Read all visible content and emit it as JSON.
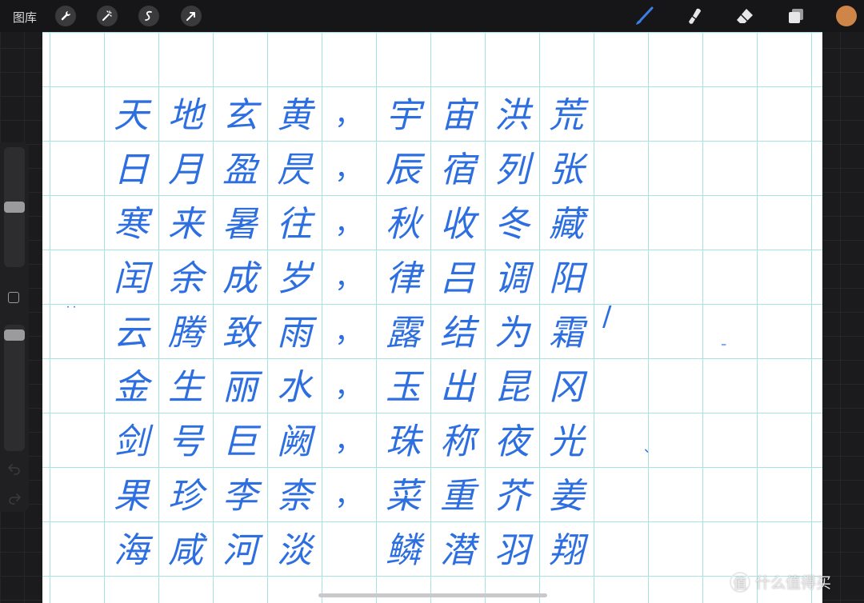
{
  "topbar": {
    "gallery_label": "图库",
    "left_tools": [
      "wrench-icon",
      "magic-wand-icon",
      "selection-icon",
      "transform-arrow-icon"
    ],
    "right_tools": [
      "brush-icon",
      "smudge-icon",
      "eraser-icon",
      "layers-icon"
    ],
    "active_color": "#cf8448",
    "brush_color": "#3b7ee8"
  },
  "sidebar": {
    "brush_size_level": 0.35,
    "opacity_level": 0.1
  },
  "canvas": {
    "ink_color": "#2d6fe0",
    "grid_color": "#a6e4e0",
    "lines": [
      {
        "left": [
          "天",
          "地",
          "玄",
          "黄"
        ],
        "mid": "，",
        "right": [
          "宇",
          "宙",
          "洪",
          "荒"
        ]
      },
      {
        "left": [
          "日",
          "月",
          "盈",
          "昃"
        ],
        "mid": "，",
        "right": [
          "辰",
          "宿",
          "列",
          "张"
        ]
      },
      {
        "left": [
          "寒",
          "来",
          "暑",
          "往"
        ],
        "mid": "，",
        "right": [
          "秋",
          "收",
          "冬",
          "藏"
        ]
      },
      {
        "left": [
          "闰",
          "余",
          "成",
          "岁"
        ],
        "mid": "，",
        "right": [
          "律",
          "吕",
          "调",
          "阳"
        ]
      },
      {
        "left": [
          "云",
          "腾",
          "致",
          "雨"
        ],
        "mid": "，",
        "right": [
          "露",
          "结",
          "为",
          "霜"
        ]
      },
      {
        "left": [
          "金",
          "生",
          "丽",
          "水"
        ],
        "mid": "，",
        "right": [
          "玉",
          "出",
          "昆",
          "冈"
        ]
      },
      {
        "left": [
          "剑",
          "号",
          "巨",
          "阙"
        ],
        "mid": "，",
        "right": [
          "珠",
          "称",
          "夜",
          "光"
        ]
      },
      {
        "left": [
          "果",
          "珍",
          "李",
          "柰"
        ],
        "mid": "，",
        "right": [
          "菜",
          "重",
          "芥",
          "姜"
        ]
      },
      {
        "left": [
          "海",
          "咸",
          "河",
          "淡"
        ],
        "mid": "",
        "right": [
          "鳞",
          "潜",
          "羽",
          "翔"
        ]
      }
    ]
  },
  "watermark": {
    "logo": "值",
    "text": "什么值得买"
  }
}
